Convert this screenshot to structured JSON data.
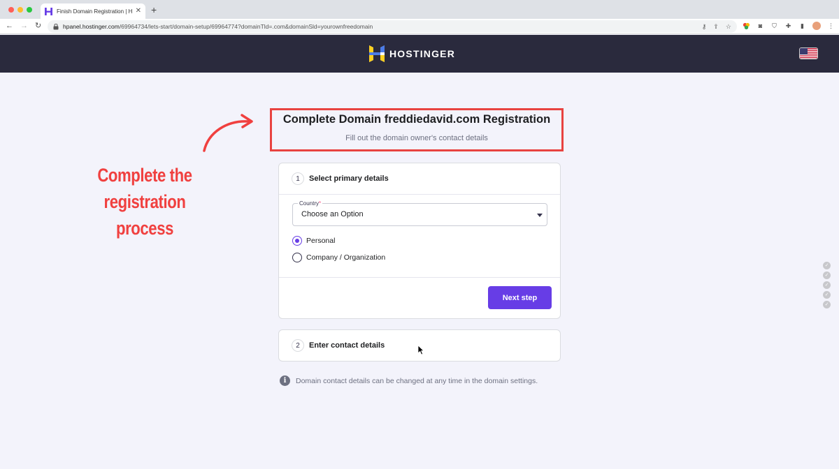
{
  "browser": {
    "tab_title": "Finish Domain Registration | H…",
    "tab_close": "✕",
    "new_tab": "+",
    "url_host": "hpanel.hostinger.com",
    "url_path": "/69964734/lets-start/domain-setup/69964774?domainTld=.com&domainSld=yourownfreedomain",
    "icons": [
      "key-icon",
      "share-icon",
      "star-icon",
      "extension-colorful-icon",
      "camera-icon",
      "shield-icon",
      "puzzle-icon",
      "sidebar-icon",
      "avatar",
      "more-icon"
    ]
  },
  "header": {
    "brand": "HOSTINGER",
    "language_flag": "us-flag"
  },
  "annotation": {
    "line1": "Complete the registration",
    "line2": "process",
    "color": "#f0403f"
  },
  "page": {
    "title": "Complete Domain freddiedavid.com Registration",
    "subtitle": "Fill out the domain owner's contact details"
  },
  "step1": {
    "number": "1",
    "label": "Select primary details",
    "country_label": "Country",
    "country_required": "*",
    "country_value": "Choose an Option",
    "options": [
      {
        "label": "Personal",
        "checked": true
      },
      {
        "label": "Company / Organization",
        "checked": false
      }
    ],
    "next_label": "Next step"
  },
  "step2": {
    "number": "2",
    "label": "Enter contact details"
  },
  "info": {
    "icon": "i",
    "text": "Domain contact details can be changed at any time in the domain settings."
  },
  "colors": {
    "primary": "#673de6",
    "header_bg": "#2a2a3d",
    "highlight_border": "#e84340"
  }
}
